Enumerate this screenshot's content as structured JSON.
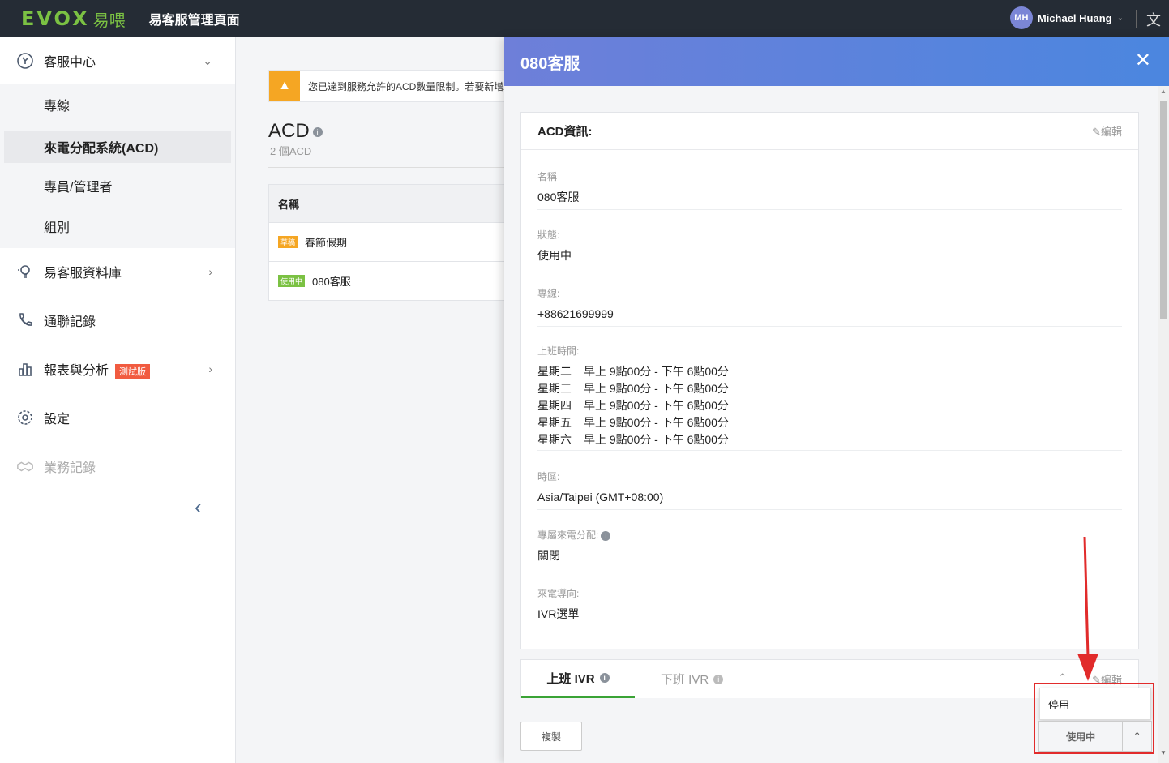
{
  "header": {
    "logo_text": "EVOX",
    "logo_cn": "易喂",
    "page_title": "易客服管理頁面",
    "user_initials": "MH",
    "user_name": "Michael Huang"
  },
  "sidebar": {
    "items": [
      {
        "label": "客服中心"
      },
      {
        "label": "易客服資料庫"
      },
      {
        "label": "通聯記錄"
      },
      {
        "label": "報表與分析",
        "badge": "測試版"
      },
      {
        "label": "設定"
      },
      {
        "label": "業務記錄"
      }
    ],
    "sub_items": [
      {
        "label": "專線"
      },
      {
        "label": "來電分配系統(ACD)"
      },
      {
        "label": "專員/管理者"
      },
      {
        "label": "組別"
      }
    ]
  },
  "main": {
    "alert_text": "您已達到服務允許的ACD數量限制。若要新增A",
    "title": "ACD",
    "count": "2 個ACD",
    "table_header": "名稱",
    "rows": [
      {
        "badge": "草稿",
        "name": "春節假期"
      },
      {
        "badge": "使用中",
        "name": "080客服"
      }
    ]
  },
  "drawer": {
    "title": "080客服",
    "card_title": "ACD資訊:",
    "edit_label": "編輯",
    "fields": {
      "name_label": "名稱",
      "name_value": "080客服",
      "status_label": "狀態:",
      "status_value": "使用中",
      "line_label": "專線:",
      "line_value": "+88621699999",
      "hours_label": "上班時間:",
      "hours": [
        {
          "day": "星期二",
          "time": "早上 9點00分 - 下午 6點00分"
        },
        {
          "day": "星期三",
          "time": "早上 9點00分 - 下午 6點00分"
        },
        {
          "day": "星期四",
          "time": "早上 9點00分 - 下午 6點00分"
        },
        {
          "day": "星期五",
          "time": "早上 9點00分 - 下午 6點00分"
        },
        {
          "day": "星期六",
          "time": "早上 9點00分 - 下午 6點00分"
        }
      ],
      "tz_label": "時區:",
      "tz_value": "Asia/Taipei (GMT+08:00)",
      "dedicated_label": "專屬來電分配:",
      "dedicated_value": "關閉",
      "routing_label": "來電導向:",
      "routing_value": "IVR選單"
    },
    "tabs": {
      "on_label": "上班 IVR",
      "off_label": "下班 IVR",
      "edit_label": "編輯"
    },
    "copy_button": "複製",
    "dropdown_option": "停用",
    "status_button": "使用中"
  },
  "colors": {
    "brand_green": "#7bc143",
    "header_gradient_start": "#6e7fd9",
    "header_gradient_end": "#4b86df",
    "highlight_red": "#e12b2b"
  }
}
